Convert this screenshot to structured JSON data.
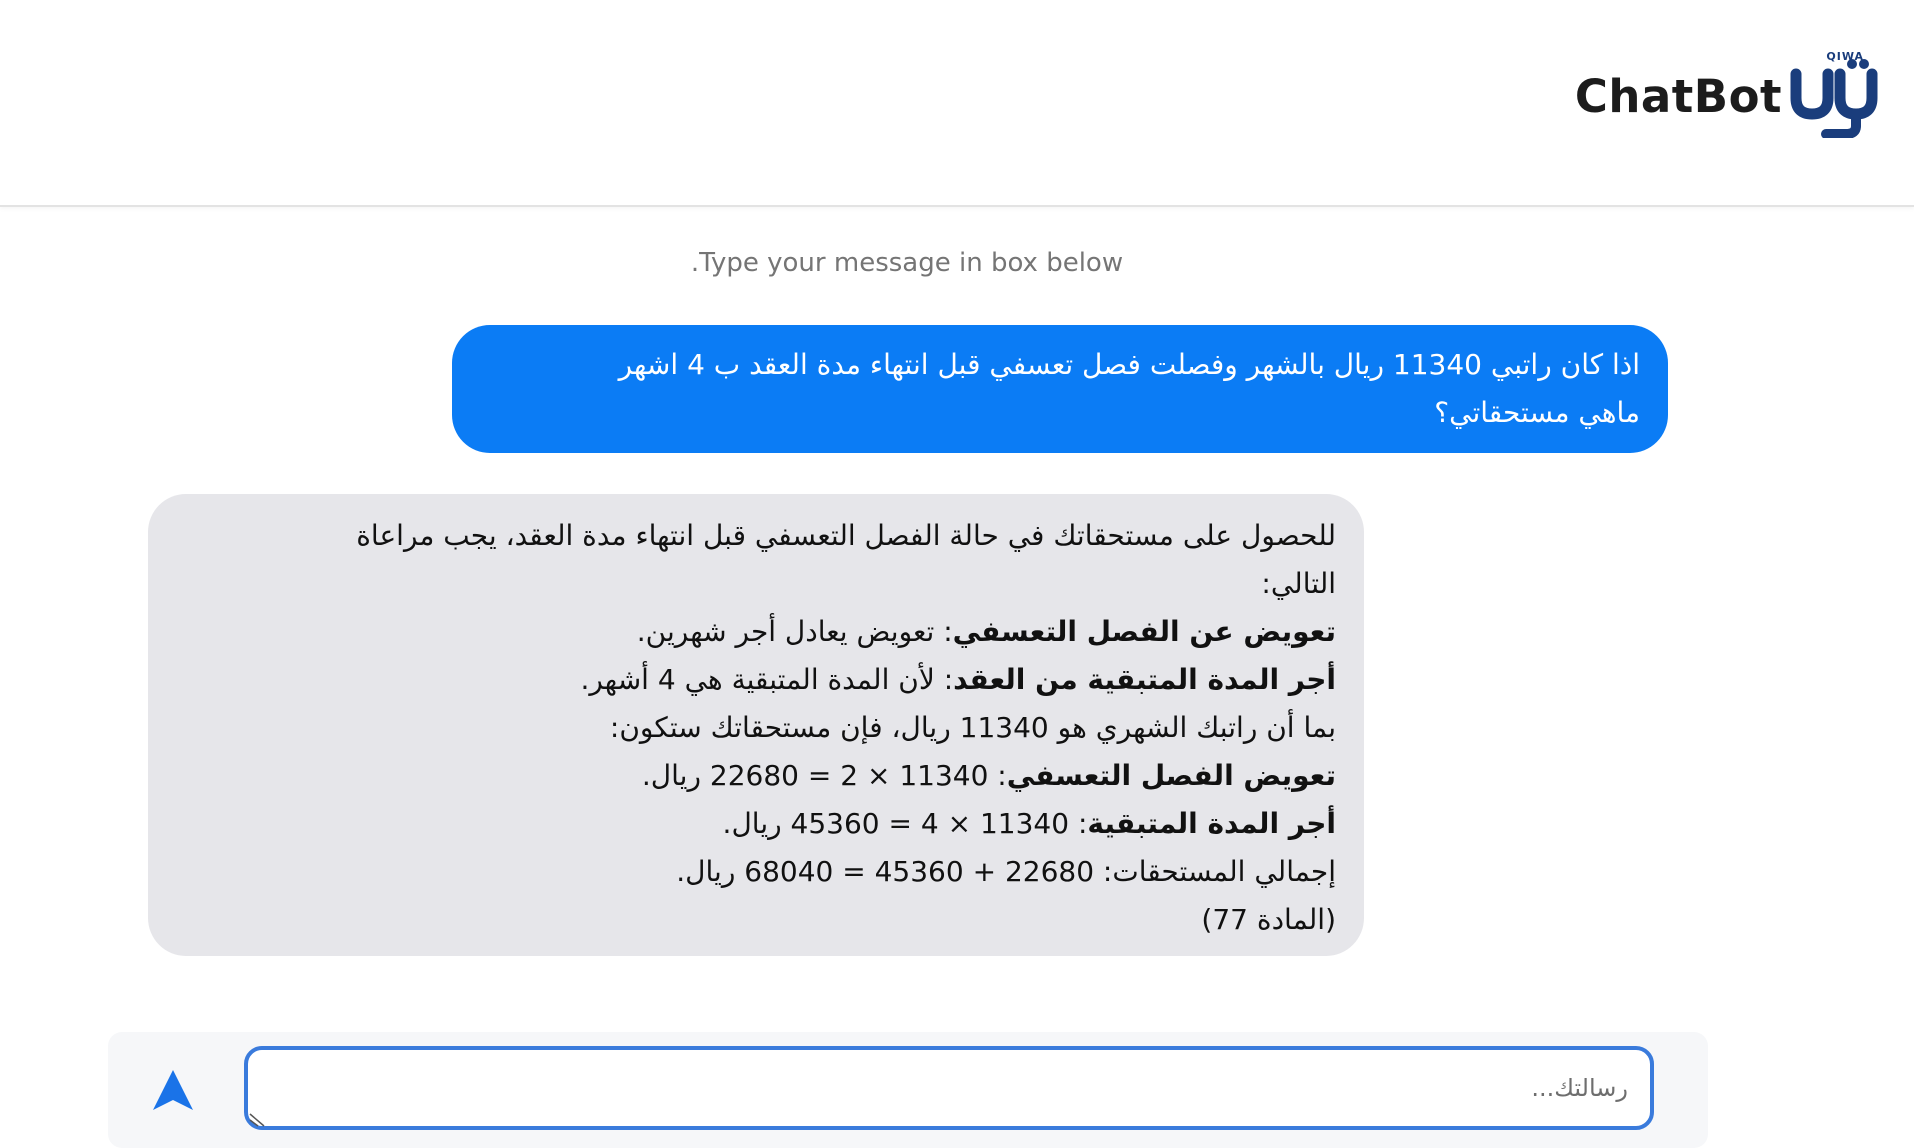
{
  "header": {
    "logo_text": "ChatBot",
    "logo_small": "QIWA",
    "brand_color": "#1a3d7c"
  },
  "hint": ".Type your message in box below",
  "messages": {
    "user": {
      "line1": "اذا كان راتبي 11340 ريال بالشهر وفصلت فصل تعسفي قبل انتهاء مدة العقد ب 4 اشهر",
      "line2": "ماهي مستحقاتي؟"
    },
    "bot": {
      "intro1": "للحصول على مستحقاتك في حالة الفصل التعسفي قبل انتهاء مدة العقد، يجب مراعاة",
      "intro2": "التالي:",
      "item1_bold": "تعويض عن الفصل التعسفي",
      "item1_text": ": تعويض يعادل أجر شهرين.",
      "item2_bold": "أجر المدة المتبقية من العقد",
      "item2_text": ": لأن المدة المتبقية هي 4 أشهر.",
      "calc_intro": "بما أن راتبك الشهري هو 11340 ريال، فإن مستحقاتك ستكون:",
      "calc1_bold": "تعويض الفصل التعسفي",
      "calc1_text": ": 11340 × 2 = 22680 ريال.",
      "calc2_bold": "أجر المدة المتبقية",
      "calc2_text": ": 11340 × 4 = 45360 ريال.",
      "total": "إجمالي المستحقات: 22680 + 45360 = 68040 ريال.",
      "reference": "(المادة 77)"
    }
  },
  "composer": {
    "placeholder": "رسالتك...",
    "value": "",
    "send_icon": "send-arrow-icon",
    "accent": "#1a73e8"
  },
  "colors": {
    "user_bubble": "#0b7cf5",
    "bot_bubble": "#e6e6ea",
    "input_border": "#3a7bdc"
  }
}
